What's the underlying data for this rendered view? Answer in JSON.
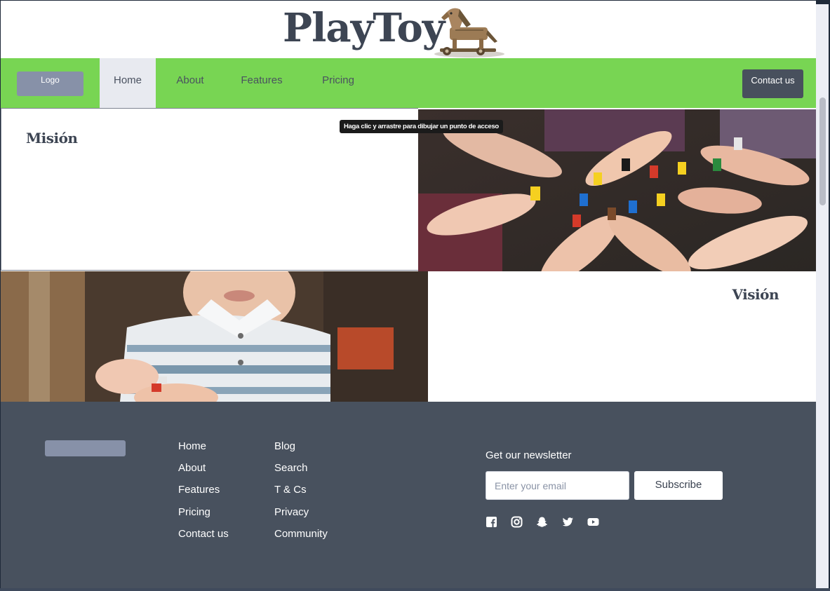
{
  "brand": {
    "name": "PlayToy",
    "logo_icon": "rocking-horse-icon"
  },
  "nav": {
    "logo_label": "Logo",
    "items": [
      {
        "label": "Home",
        "active": true
      },
      {
        "label": "About",
        "active": false
      },
      {
        "label": "Features",
        "active": false
      },
      {
        "label": "Pricing",
        "active": false
      }
    ],
    "contact_label": "Contact us"
  },
  "mission": {
    "title": "Misión"
  },
  "vision": {
    "title": "Visión"
  },
  "tooltip": {
    "text": "Haga clic y arrastre para dibujar un punto de acceso"
  },
  "footer": {
    "col1": [
      "Home",
      "About",
      "Features",
      "Pricing",
      "Contact us"
    ],
    "col2": [
      "Blog",
      "Search",
      "T & Cs",
      "Privacy",
      "Community"
    ],
    "newsletter_label": "Get our newsletter",
    "email_placeholder": "Enter your email",
    "subscribe_label": "Subscribe",
    "social_icons": [
      "facebook-icon",
      "instagram-icon",
      "snapchat-icon",
      "twitter-icon",
      "youtube-icon"
    ]
  },
  "colors": {
    "nav_bg": "#78d553",
    "footer_bg": "#48515e",
    "accent_dark": "#48505d",
    "logo_placeholder": "#8791a8"
  }
}
